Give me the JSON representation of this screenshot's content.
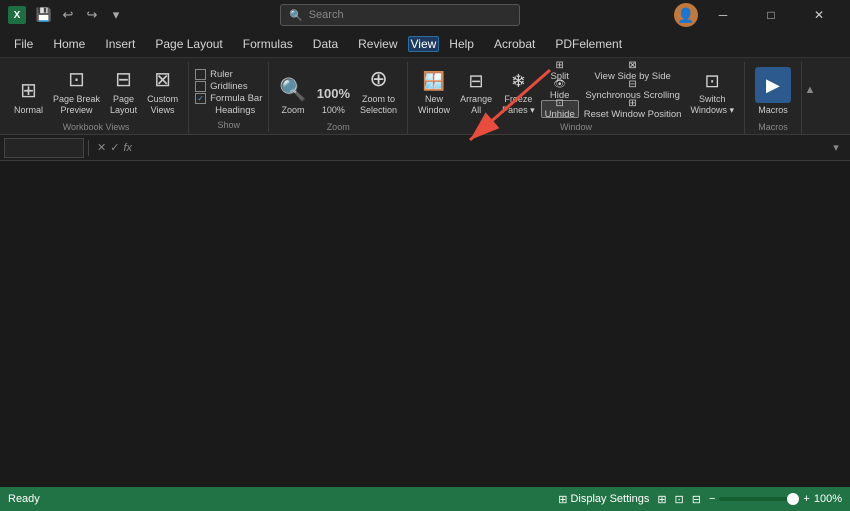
{
  "titlebar": {
    "app_name": "Excel",
    "excel_letter": "X",
    "title": "Excel",
    "search_placeholder": "Search",
    "undo_icon": "↩",
    "redo_icon": "↪",
    "save_icon": "💾",
    "minimize_icon": "─",
    "maximize_icon": "□",
    "close_icon": "✕"
  },
  "menu": {
    "items": [
      "File",
      "Home",
      "Insert",
      "Page Layout",
      "Formulas",
      "Data",
      "Review",
      "View",
      "Help",
      "Acrobat",
      "PDFelement"
    ],
    "active": "View"
  },
  "ribbon": {
    "groups": [
      {
        "label": "Workbook Views",
        "buttons": [
          {
            "icon": "⊞",
            "label": "Normal"
          },
          {
            "icon": "⊡",
            "label": "Page Break\nPreview"
          },
          {
            "icon": "⊟",
            "label": "Page\nLayout"
          },
          {
            "icon": "⊠",
            "label": "Custom\nViews"
          }
        ],
        "checkboxes": []
      },
      {
        "label": "Show",
        "checkboxes": [
          {
            "label": "Ruler",
            "checked": false
          },
          {
            "label": "Gridlines",
            "checked": false
          },
          {
            "label": "Formula Bar",
            "checked": true
          },
          {
            "label": "Headings",
            "checked": false
          }
        ]
      },
      {
        "label": "Zoom",
        "buttons": [
          {
            "icon": "🔍",
            "label": "Zoom"
          },
          {
            "text": "100%",
            "label": "100%"
          },
          {
            "icon": "⊕",
            "label": "Zoom to\nSelection"
          }
        ]
      },
      {
        "label": "Window",
        "buttons_main": [
          {
            "icon": "⊞",
            "label": "New\nWindow"
          },
          {
            "icon": "⊟",
            "label": "Arrange\nAll"
          },
          {
            "icon": "❄",
            "label": "Freeze\nPanes ▾"
          }
        ],
        "buttons_stacked": [
          {
            "icon": "⊠",
            "label": "Split"
          },
          {
            "icon": "👁",
            "label": "Hide"
          },
          {
            "icon": "⊡",
            "label": "Unhide",
            "highlighted": true
          }
        ],
        "buttons_right": [
          {
            "icon": "⊟",
            "label": "View Side by Side"
          },
          {
            "icon": "⊡",
            "label": "Synchronous Scrolling"
          },
          {
            "icon": "⊞",
            "label": "Reset Window Position"
          },
          {
            "icon": "⊠",
            "label": "Switch\nWindows ▾"
          }
        ]
      },
      {
        "label": "Macros",
        "buttons": [
          {
            "icon": "▶",
            "label": "Macros"
          }
        ]
      }
    ],
    "collapse_icon": "▲"
  },
  "formulabar": {
    "namebox_value": "",
    "cancel_label": "✕",
    "confirm_label": "✓",
    "function_label": "fx",
    "formula_value": ""
  },
  "statusbar": {
    "ready_label": "Ready",
    "display_settings": "Display Settings",
    "zoom_percent": "100%",
    "view_icons": [
      "⊞",
      "⊡",
      "⊟"
    ]
  },
  "annotation": {
    "arrow_color": "#e74c3c"
  }
}
